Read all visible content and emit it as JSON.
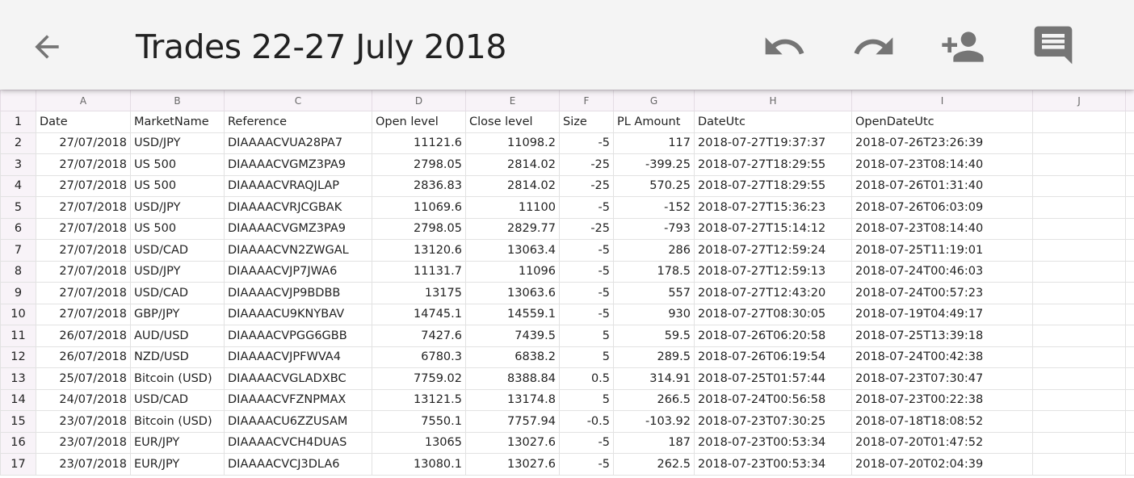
{
  "toolbar": {
    "title": "Trades 22-27 July 2018",
    "back_icon": "arrow-left-icon",
    "undo_icon": "undo-icon",
    "redo_icon": "redo-icon",
    "share_icon": "add-person-icon",
    "comment_icon": "comment-icon",
    "icon_color": "#757575"
  },
  "columns": [
    "A",
    "B",
    "C",
    "D",
    "E",
    "F",
    "G",
    "H",
    "I",
    "J"
  ],
  "row_numbers": [
    "1",
    "2",
    "3",
    "4",
    "5",
    "6",
    "7",
    "8",
    "9",
    "10",
    "11",
    "12",
    "13",
    "14",
    "15",
    "16",
    "17"
  ],
  "rows": [
    [
      "Date",
      "MarketName",
      "Reference",
      "Open level",
      "Close level",
      "Size",
      "PL Amount",
      "DateUtc",
      "OpenDateUtc",
      ""
    ],
    [
      "27/07/2018",
      "USD/JPY",
      "DIAAAACVUA28PA7",
      "11121.6",
      "11098.2",
      "-5",
      "117",
      "2018-07-27T19:37:37",
      "2018-07-26T23:26:39",
      ""
    ],
    [
      "27/07/2018",
      "US 500",
      "DIAAAACVGMZ3PA9",
      "2798.05",
      "2814.02",
      "-25",
      "-399.25",
      "2018-07-27T18:29:55",
      "2018-07-23T08:14:40",
      ""
    ],
    [
      "27/07/2018",
      "US 500",
      "DIAAAACVRAQJLAP",
      "2836.83",
      "2814.02",
      "-25",
      "570.25",
      "2018-07-27T18:29:55",
      "2018-07-26T01:31:40",
      ""
    ],
    [
      "27/07/2018",
      "USD/JPY",
      "DIAAAACVRJCGBAK",
      "11069.6",
      "11100",
      "-5",
      "-152",
      "2018-07-27T15:36:23",
      "2018-07-26T06:03:09",
      ""
    ],
    [
      "27/07/2018",
      "US 500",
      "DIAAAACVGMZ3PA9",
      "2798.05",
      "2829.77",
      "-25",
      "-793",
      "2018-07-27T15:14:12",
      "2018-07-23T08:14:40",
      ""
    ],
    [
      "27/07/2018",
      "USD/CAD",
      "DIAAAACVN2ZWGAL",
      "13120.6",
      "13063.4",
      "-5",
      "286",
      "2018-07-27T12:59:24",
      "2018-07-25T11:19:01",
      ""
    ],
    [
      "27/07/2018",
      "USD/JPY",
      "DIAAAACVJP7JWA6",
      "11131.7",
      "11096",
      "-5",
      "178.5",
      "2018-07-27T12:59:13",
      "2018-07-24T00:46:03",
      ""
    ],
    [
      "27/07/2018",
      "USD/CAD",
      "DIAAAACVJP9BDBB",
      "13175",
      "13063.6",
      "-5",
      "557",
      "2018-07-27T12:43:20",
      "2018-07-24T00:57:23",
      ""
    ],
    [
      "27/07/2018",
      "GBP/JPY",
      "DIAAAACU9KNYBAV",
      "14745.1",
      "14559.1",
      "-5",
      "930",
      "2018-07-27T08:30:05",
      "2018-07-19T04:49:17",
      ""
    ],
    [
      "26/07/2018",
      "AUD/USD",
      "DIAAAACVPGG6GBB",
      "7427.6",
      "7439.5",
      "5",
      "59.5",
      "2018-07-26T06:20:58",
      "2018-07-25T13:39:18",
      ""
    ],
    [
      "26/07/2018",
      "NZD/USD",
      "DIAAAACVJPFWVA4",
      "6780.3",
      "6838.2",
      "5",
      "289.5",
      "2018-07-26T06:19:54",
      "2018-07-24T00:42:38",
      ""
    ],
    [
      "25/07/2018",
      "Bitcoin (USD)",
      "DIAAAACVGLADXBC",
      "7759.02",
      "8388.84",
      "0.5",
      "314.91",
      "2018-07-25T01:57:44",
      "2018-07-23T07:30:47",
      ""
    ],
    [
      "24/07/2018",
      "USD/CAD",
      "DIAAAACVFZNPMAX",
      "13121.5",
      "13174.8",
      "5",
      "266.5",
      "2018-07-24T00:56:58",
      "2018-07-23T00:22:38",
      ""
    ],
    [
      "23/07/2018",
      "Bitcoin (USD)",
      "DIAAAACU6ZZUSAM",
      "7550.1",
      "7757.94",
      "-0.5",
      "-103.92",
      "2018-07-23T07:30:25",
      "2018-07-18T18:08:52",
      ""
    ],
    [
      "23/07/2018",
      "EUR/JPY",
      "DIAAAACVCH4DUAS",
      "13065",
      "13027.6",
      "-5",
      "187",
      "2018-07-23T00:53:34",
      "2018-07-20T01:47:52",
      ""
    ],
    [
      "23/07/2018",
      "EUR/JPY",
      "DIAAAACVCJ3DLA6",
      "13080.1",
      "13027.6",
      "-5",
      "262.5",
      "2018-07-23T00:53:34",
      "2018-07-20T02:04:39",
      ""
    ]
  ]
}
